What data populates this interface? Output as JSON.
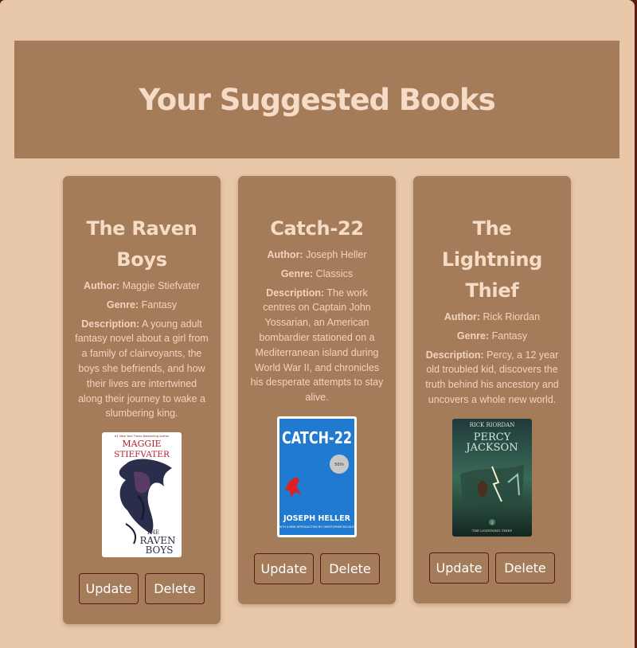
{
  "page": {
    "title": "Your Suggested Books"
  },
  "labels": {
    "author": "Author:",
    "genre": "Genre:",
    "description": "Description:"
  },
  "buttons": {
    "update": "Update",
    "delete": "Delete"
  },
  "books": [
    {
      "title": "The Raven Boys",
      "author": "Maggie Stiefvater",
      "genre": "Fantasy",
      "description": "A young adult fantasy novel about a girl from a family of clairvoyants, the boys she befriends, and how their lives are intertwined along their journey to wake a slumbering king.",
      "cover": {
        "top_text": "#1 New York Times Bestselling Author",
        "author_line1": "MAGGIE",
        "author_line2": "STIEFVATER",
        "title_line1": "THE",
        "title_line2": "RAVEN",
        "title_line3": "BOYS"
      }
    },
    {
      "title": "Catch-22",
      "author": "Joseph Heller",
      "genre": "Classics",
      "description": "The work centres on Captain John Yossarian, an American bombardier stationed on a Mediterranean island during World War II, and chronicles his desperate attempts to stay alive.",
      "cover": {
        "title": "CATCH-22",
        "badge": "50th",
        "author": "JOSEPH HELLER",
        "subtitle": "WITH A NEW INTRODUCTION BY CHRISTOPHER BUCKLEY"
      }
    },
    {
      "title": "The Lightning Thief",
      "author": "Rick Riordan",
      "genre": "Fantasy",
      "description": "Percy, a 12 year old troubled kid, discovers the truth behind his ancestory and uncovers a whole new world.",
      "cover": {
        "author": "RICK RIORDAN",
        "series_line1": "PERCY",
        "series_line2": "JACKSON",
        "subtitle": "THE LIGHTNING THIEF",
        "number": "1"
      }
    }
  ],
  "colors": {
    "background": "#e8c6a8",
    "panel": "#a47c5a",
    "text": "#f6dcc6",
    "border": "#5a1a14"
  }
}
